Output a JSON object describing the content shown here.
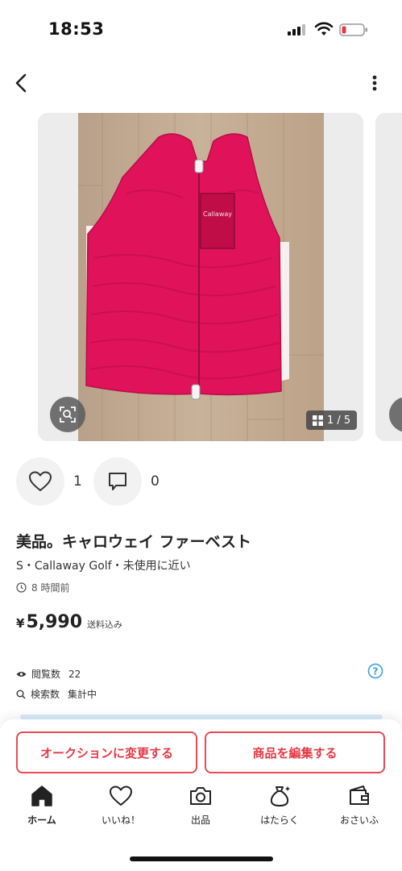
{
  "status_bar": {
    "time": "18:53"
  },
  "nav": {
    "back_icon": "chevron-left-icon",
    "more_icon": "more-vertical-icon"
  },
  "gallery": {
    "page_indicator": "1 / 5",
    "current_page": 1,
    "total_pages": 5
  },
  "actions": {
    "like_count": "1",
    "comment_count": "0"
  },
  "item": {
    "title": "美品。キャロウェイ ファーベスト",
    "meta": "S・Callaway Golf・未使用に近い",
    "posted": "8 時間前",
    "currency": "¥",
    "price": "5,990",
    "price_note": "送料込み"
  },
  "stats": {
    "views_label": "閲覧数",
    "views_value": "22",
    "search_label": "検索数",
    "search_value": "集計中"
  },
  "buttons": {
    "auction": "オークションに変更する",
    "edit": "商品を編集する"
  },
  "tabs": [
    {
      "label": "ホーム",
      "icon": "home-icon"
    },
    {
      "label": "いいね！",
      "icon": "heart-icon"
    },
    {
      "label": "出品",
      "icon": "camera-icon"
    },
    {
      "label": "はたらく",
      "icon": "money-bag-icon"
    },
    {
      "label": "おさいふ",
      "icon": "wallet-icon"
    }
  ],
  "colors": {
    "accent": "#e53945",
    "info": "#3aa0d8",
    "tab_active": "#111111"
  }
}
